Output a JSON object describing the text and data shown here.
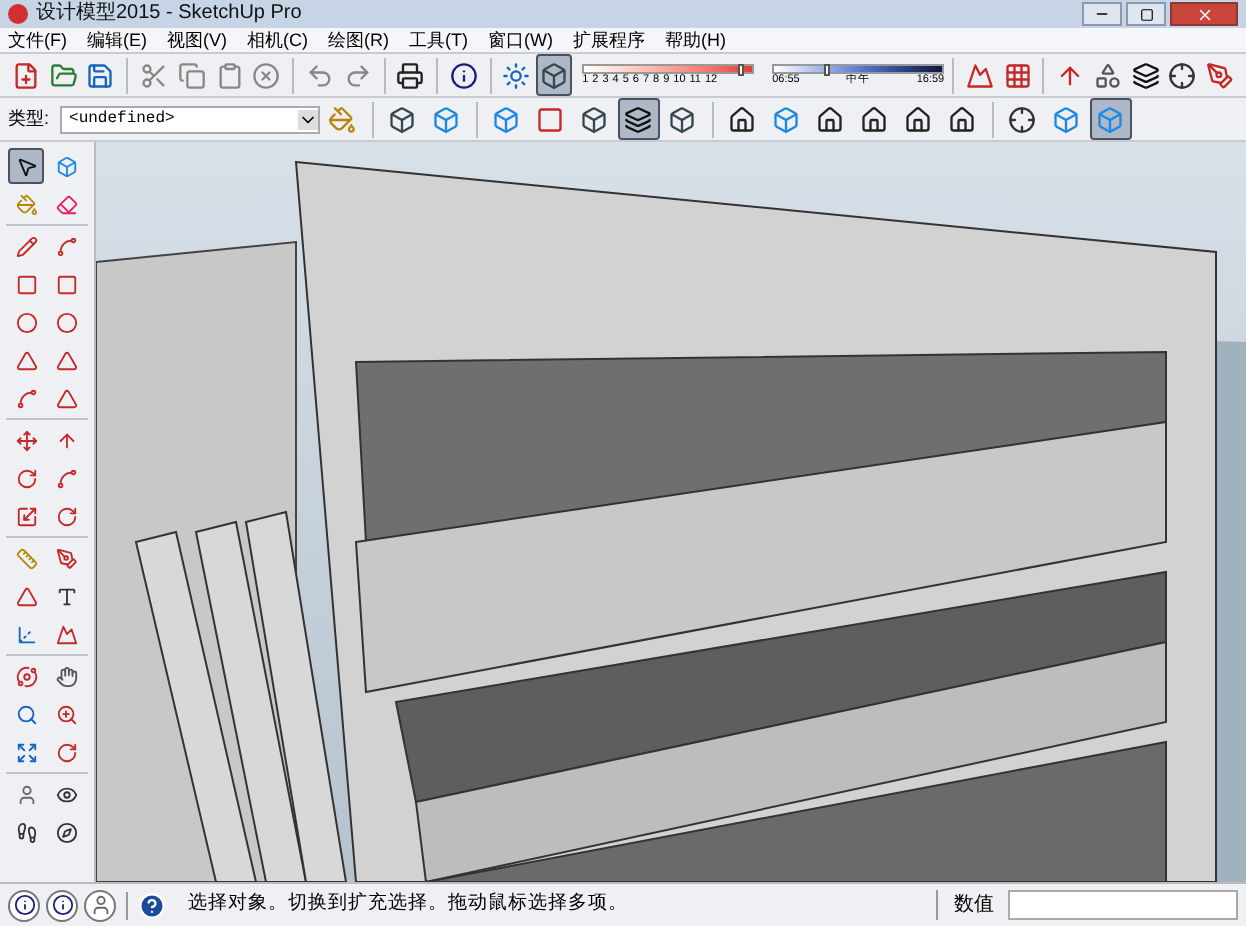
{
  "window": {
    "title": "设计模型2015 - SketchUp Pro"
  },
  "menu": [
    "文件(F)",
    "编辑(E)",
    "视图(V)",
    "相机(C)",
    "绘图(R)",
    "工具(T)",
    "窗口(W)",
    "扩展程序",
    "帮助(H)"
  ],
  "toolbar_1": [
    [
      {
        "kind": "new",
        "selected": false
      },
      {
        "kind": "open",
        "selected": false
      },
      {
        "kind": "save",
        "selected": false
      }
    ],
    [
      {
        "kind": "cut",
        "selected": false
      },
      {
        "kind": "copy",
        "selected": false
      },
      {
        "kind": "paste",
        "selected": false
      },
      {
        "kind": "erase",
        "selected": false
      }
    ],
    [
      {
        "kind": "undo",
        "selected": false
      },
      {
        "kind": "redo",
        "selected": false
      }
    ],
    [
      {
        "kind": "print",
        "selected": false
      }
    ],
    [
      {
        "kind": "info",
        "selected": false
      }
    ],
    [
      {
        "kind": "sun",
        "selected": false
      },
      {
        "kind": "cube",
        "selected": true
      }
    ]
  ],
  "shadow": {
    "months": [
      "1",
      "2",
      "3",
      "4",
      "5",
      "6",
      "7",
      "8",
      "9",
      "10",
      "11",
      "12"
    ],
    "month_slider": {
      "level": 0.92
    },
    "time_start": "06:55",
    "time_mid": "中午",
    "time_end": "16:59",
    "time_slider": {
      "level": 0.3
    }
  },
  "toolbar_1_end": [
    [
      {
        "kind": "mountain",
        "selected": false
      },
      {
        "kind": "grid",
        "selected": false
      }
    ],
    [
      {
        "kind": "arrowup",
        "selected": false
      },
      {
        "kind": "shapes",
        "selected": false
      },
      {
        "kind": "layers",
        "selected": false
      },
      {
        "kind": "crosshair",
        "selected": false
      },
      {
        "kind": "pen",
        "selected": false
      }
    ]
  ],
  "type_field": {
    "label": "类型:",
    "value": "<undefined>"
  },
  "toolbar_2": [
    [
      {
        "kind": "paint",
        "selected": false
      }
    ],
    [
      {
        "kind": "cube",
        "selected": false
      },
      {
        "kind": "box",
        "selected": false
      }
    ],
    [
      {
        "kind": "box",
        "selected": false
      },
      {
        "kind": "square",
        "selected": false
      },
      {
        "kind": "cube",
        "selected": false
      },
      {
        "kind": "layers",
        "selected": true
      },
      {
        "kind": "cube",
        "selected": false
      }
    ],
    [
      {
        "kind": "house",
        "selected": false
      },
      {
        "kind": "box",
        "selected": false
      },
      {
        "kind": "house",
        "selected": false
      },
      {
        "kind": "house",
        "selected": false
      },
      {
        "kind": "house",
        "selected": false
      },
      {
        "kind": "house",
        "selected": false
      }
    ],
    [
      {
        "kind": "crosshair",
        "selected": false
      },
      {
        "kind": "box",
        "selected": false
      },
      {
        "kind": "box",
        "selected": true
      }
    ]
  ],
  "palette": [
    [
      {
        "kind": "select",
        "selected": true
      },
      {
        "kind": "box",
        "selected": false
      },
      {
        "kind": "paint",
        "selected": false
      },
      {
        "kind": "eraser",
        "selected": false
      }
    ],
    [
      {
        "kind": "pencil",
        "selected": false
      },
      {
        "kind": "spline",
        "selected": false
      },
      {
        "kind": "square",
        "selected": false
      },
      {
        "kind": "square",
        "selected": false
      },
      {
        "kind": "circle",
        "selected": false
      },
      {
        "kind": "circle",
        "selected": false
      },
      {
        "kind": "triangle",
        "selected": false
      },
      {
        "kind": "triangle",
        "selected": false
      },
      {
        "kind": "spline",
        "selected": false
      },
      {
        "kind": "triangle",
        "selected": false
      }
    ],
    [
      {
        "kind": "move",
        "selected": false
      },
      {
        "kind": "arrowup",
        "selected": false
      },
      {
        "kind": "rotate",
        "selected": false
      },
      {
        "kind": "spline",
        "selected": false
      },
      {
        "kind": "scale",
        "selected": false
      },
      {
        "kind": "rotate",
        "selected": false
      }
    ],
    [
      {
        "kind": "ruler",
        "selected": false
      },
      {
        "kind": "pen",
        "selected": false
      },
      {
        "kind": "triangle",
        "selected": false
      },
      {
        "kind": "text",
        "selected": false
      },
      {
        "kind": "axes",
        "selected": false
      },
      {
        "kind": "mountain",
        "selected": false
      }
    ],
    [
      {
        "kind": "orbit",
        "selected": false
      },
      {
        "kind": "hand",
        "selected": false
      },
      {
        "kind": "search",
        "selected": false
      },
      {
        "kind": "zoomwin",
        "selected": false
      },
      {
        "kind": "expand",
        "selected": false
      },
      {
        "kind": "rotate",
        "selected": false
      }
    ],
    [
      {
        "kind": "user",
        "selected": false
      },
      {
        "kind": "eye",
        "selected": false
      },
      {
        "kind": "footprints",
        "selected": false
      },
      {
        "kind": "compass",
        "selected": false
      }
    ]
  ],
  "status_bar": {
    "buttons": [
      {
        "kind": "info"
      },
      {
        "kind": "info"
      },
      {
        "kind": "user"
      }
    ],
    "message": "选择对象。切换到扩充选择。拖动鼠标选择多项。",
    "value_label": "数值"
  }
}
